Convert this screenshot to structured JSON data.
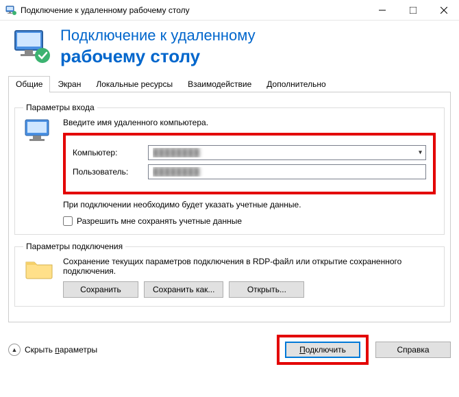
{
  "window": {
    "title": "Подключение к удаленному рабочему столу"
  },
  "header": {
    "line1": "Подключение к удаленному",
    "line2": "рабочему столу"
  },
  "tabs": {
    "general": "Общие",
    "screen": "Экран",
    "local": "Локальные ресурсы",
    "interaction": "Взаимодействие",
    "advanced": "Дополнительно"
  },
  "login_group": {
    "legend": "Параметры входа",
    "intro": "Введите имя удаленного компьютера.",
    "computer_label": "Компьютер:",
    "computer_value": "████████",
    "user_label": "Пользователь:",
    "user_value": "████████",
    "hint": "При подключении необходимо будет указать учетные данные.",
    "checkbox_label": "Разрешить мне сохранять учетные данные"
  },
  "conn_group": {
    "legend": "Параметры подключения",
    "desc": "Сохранение текущих параметров подключения в RDP-файл или открытие сохраненного подключения.",
    "save": "Сохранить",
    "save_as": "Сохранить как...",
    "open": "Открыть..."
  },
  "bottom": {
    "hide_params_pre": "Скрыть ",
    "hide_params_u": "п",
    "hide_params_post": "араметры",
    "connect_pre": "",
    "connect_u": "П",
    "connect_post": "одключить",
    "help": "Справка"
  }
}
